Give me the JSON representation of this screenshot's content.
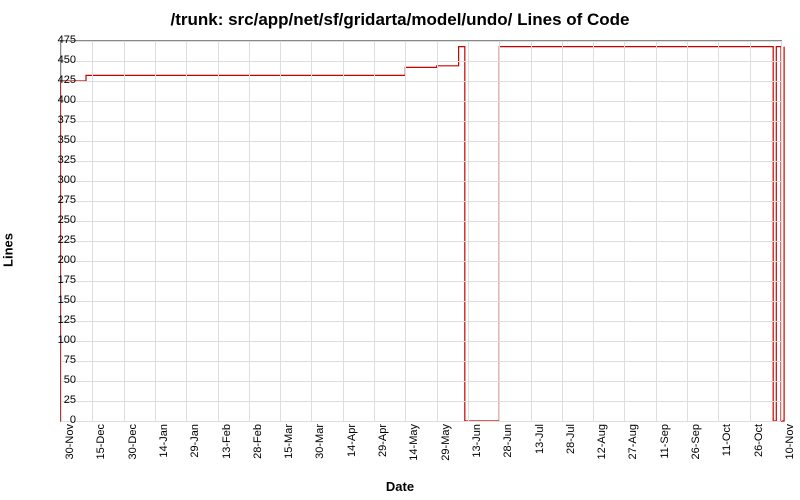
{
  "chart_data": {
    "type": "line",
    "title": "/trunk: src/app/net/sf/gridarta/model/undo/ Lines of Code",
    "xlabel": "Date",
    "ylabel": "Lines",
    "ylim": [
      0,
      475
    ],
    "yticks": [
      0,
      25,
      50,
      75,
      100,
      125,
      150,
      175,
      200,
      225,
      250,
      275,
      300,
      325,
      350,
      375,
      400,
      425,
      450,
      475
    ],
    "xticks": [
      "30-Nov",
      "15-Dec",
      "30-Dec",
      "14-Jan",
      "29-Jan",
      "13-Feb",
      "28-Feb",
      "15-Mar",
      "30-Mar",
      "14-Apr",
      "29-Apr",
      "14-May",
      "29-May",
      "13-Jun",
      "28-Jun",
      "13-Jul",
      "28-Jul",
      "12-Aug",
      "27-Aug",
      "11-Sep",
      "26-Sep",
      "11-Oct",
      "26-Oct",
      "10-Nov"
    ],
    "series": [
      {
        "name": "Lines of Code",
        "color": "#cc0000",
        "points": [
          {
            "xi": 0.0,
            "y": 0
          },
          {
            "xi": 0.0,
            "y": 425
          },
          {
            "xi": 0.8,
            "y": 425
          },
          {
            "xi": 0.8,
            "y": 432
          },
          {
            "xi": 11.0,
            "y": 432
          },
          {
            "xi": 11.0,
            "y": 442
          },
          {
            "xi": 12.0,
            "y": 442
          },
          {
            "xi": 12.0,
            "y": 444
          },
          {
            "xi": 12.7,
            "y": 444
          },
          {
            "xi": 12.7,
            "y": 468
          },
          {
            "xi": 12.9,
            "y": 468
          },
          {
            "xi": 12.9,
            "y": 0
          },
          {
            "xi": 14.0,
            "y": 0
          },
          {
            "xi": 14.0,
            "y": 468
          },
          {
            "xi": 22.75,
            "y": 468
          },
          {
            "xi": 22.75,
            "y": 0
          },
          {
            "xi": 22.85,
            "y": 0
          },
          {
            "xi": 22.85,
            "y": 468
          },
          {
            "xi": 23.0,
            "y": 468
          },
          {
            "xi": 23.0,
            "y": 0
          },
          {
            "xi": 23.1,
            "y": 0
          },
          {
            "xi": 23.1,
            "y": 468
          }
        ]
      }
    ]
  }
}
